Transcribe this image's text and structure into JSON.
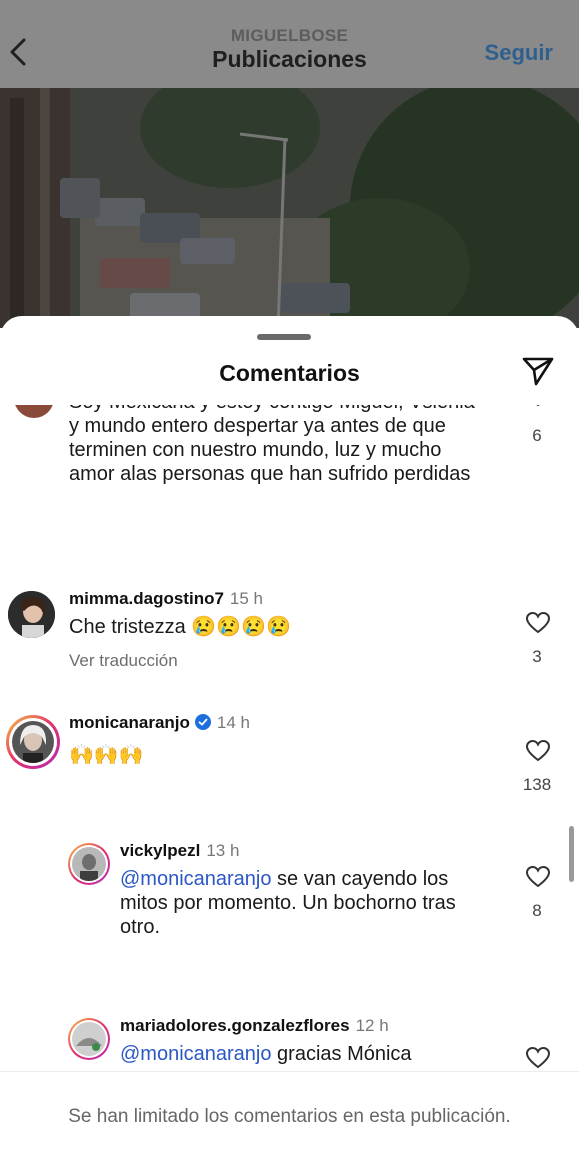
{
  "header": {
    "account_name": "MIGUELBOSE",
    "title": "Publicaciones",
    "follow_label": "Seguir"
  },
  "sheet": {
    "title": "Comentarios",
    "grabber": "drag-handle"
  },
  "comments": [
    {
      "text": "Soy Mexicana y estoy contigo Miguel, Vslenia y mundo entero despertar ya antes de que terminen con nuestro mundo, luz y mucho amor alas personas que han sufrido perdidas",
      "likes": "6"
    },
    {
      "username": "mimma.dagostino7",
      "time": "15 h",
      "text": "Che tristezza 😢😢😢😢",
      "translate_label": "Ver traducción",
      "likes": "3"
    },
    {
      "username": "monicanaranjo",
      "time": "14 h",
      "verified": true,
      "text": "🙌🙌🙌",
      "likes": "138"
    },
    {
      "username": "vickylpezl",
      "time": "13 h",
      "mention": "@monicanaranjo",
      "text": " se van cayendo los mitos por momento. Un bochorno tras otro.",
      "likes": "8"
    },
    {
      "username": "mariadolores.gonzalezflores",
      "time": "12 h",
      "mention": "@monicanaranjo",
      "text": " gracias Mónica"
    }
  ],
  "footer": {
    "notice": "Se han limitado los comentarios en esta publicación."
  },
  "colors": {
    "mention": "#2b57c5",
    "follow": "#2e5f8f",
    "verified": "#1d6fe0"
  }
}
